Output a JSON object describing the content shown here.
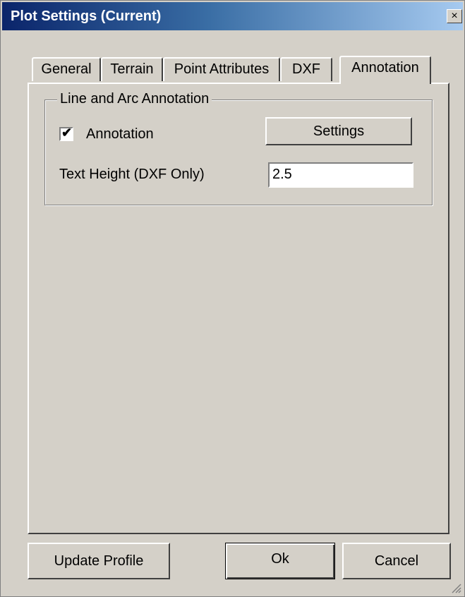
{
  "window": {
    "title": "Plot Settings  (Current)",
    "close_glyph": "×"
  },
  "tabs": [
    {
      "label": "General"
    },
    {
      "label": "Terrain"
    },
    {
      "label": "Point Attributes"
    },
    {
      "label": "DXF"
    },
    {
      "label": "Annotation",
      "active": true
    }
  ],
  "group": {
    "legend": "Line and Arc Annotation",
    "annotation_checkbox": {
      "label": "Annotation",
      "checked": true,
      "check_glyph": "✔"
    },
    "settings_button": "Settings",
    "text_height_label": "Text Height (DXF Only)",
    "text_height_value": "2.5"
  },
  "footer": {
    "update_profile": "Update Profile",
    "ok": "Ok",
    "cancel": "Cancel"
  }
}
